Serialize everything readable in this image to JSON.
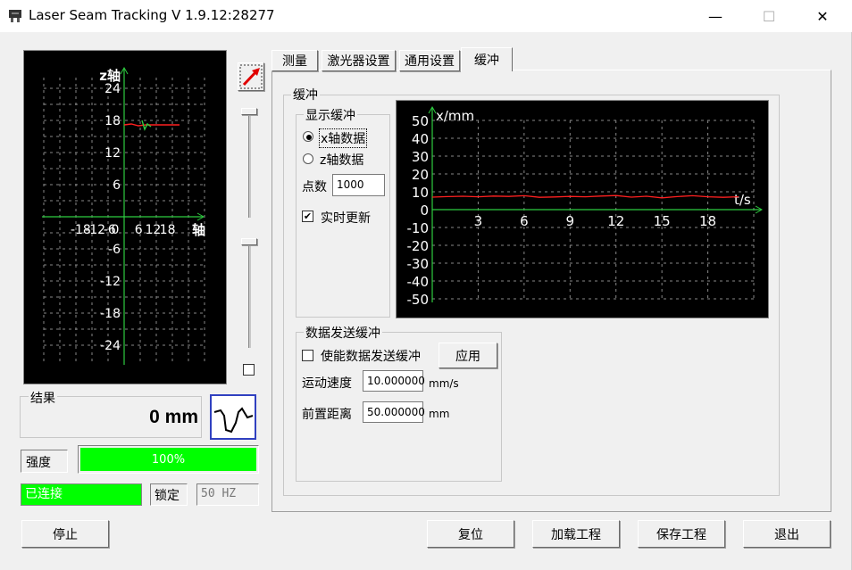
{
  "window": {
    "title": "Laser Seam Tracking V 1.9.12:28277",
    "minimize": "—",
    "maximize": "☐",
    "close": "✕"
  },
  "profile_plot": {
    "z_axis_label": "z轴",
    "x_axis_label": "轴",
    "y_ticks": [
      "24",
      "18",
      "12",
      "6",
      "-6",
      "-12",
      "-18",
      "-24"
    ],
    "x_ticks": [
      "-18",
      "-12",
      "-6",
      "0",
      "6",
      "12",
      "18"
    ]
  },
  "result": {
    "label": "结果",
    "value": "0 mm"
  },
  "strength": {
    "label": "强度",
    "value": "100%",
    "fraction": 1.0
  },
  "status": {
    "connected": "已连接",
    "lock": "锁定",
    "freq": "50 HZ"
  },
  "tabs": [
    "测量",
    "激光器设置",
    "通用设置",
    "缓冲"
  ],
  "buffer": {
    "group_title": "缓冲",
    "display_group": "显示缓冲",
    "radio_x": "x轴数据",
    "radio_z": "z轴数据",
    "points_label": "点数",
    "points_value": "1000",
    "realtime_label": "实时更新",
    "realtime_checked": "✔",
    "send_group": "数据发送缓冲",
    "enable_send_label": "使能数据发送缓冲",
    "apply_button": "应用",
    "speed_label": "运动速度",
    "speed_value": "10.000000",
    "speed_unit": "mm/s",
    "lead_label": "前置距离",
    "lead_value": "50.000000",
    "lead_unit": "mm"
  },
  "chart_data": {
    "type": "line",
    "ylabel": "x/mm",
    "xlabel": "t/s",
    "ylim": [
      -50,
      50
    ],
    "xlim": [
      0,
      21
    ],
    "y_ticks": [
      "50",
      "40",
      "30",
      "20",
      "10",
      "0",
      "-10",
      "-20",
      "-30",
      "-40",
      "-50"
    ],
    "x_ticks": [
      "3",
      "6",
      "9",
      "12",
      "15",
      "18"
    ],
    "grid": true,
    "series": [
      {
        "color": "#ff2020",
        "x": [
          0,
          1,
          2,
          3,
          4,
          5,
          6,
          7,
          8,
          9,
          10,
          11,
          12,
          13,
          14,
          15,
          16,
          17,
          18,
          19,
          20
        ],
        "y": [
          7,
          7.3,
          7.5,
          7.2,
          7.6,
          7.4,
          7.8,
          6.9,
          7.1,
          7.4,
          7.2,
          7.6,
          7.9,
          7.0,
          7.5,
          6.6,
          7.3,
          7.8,
          7.2,
          6.9,
          7.2
        ]
      }
    ]
  },
  "buttons": {
    "stop": "停止",
    "reset": "复位",
    "load": "加载工程",
    "save": "保存工程",
    "exit": "退出"
  }
}
